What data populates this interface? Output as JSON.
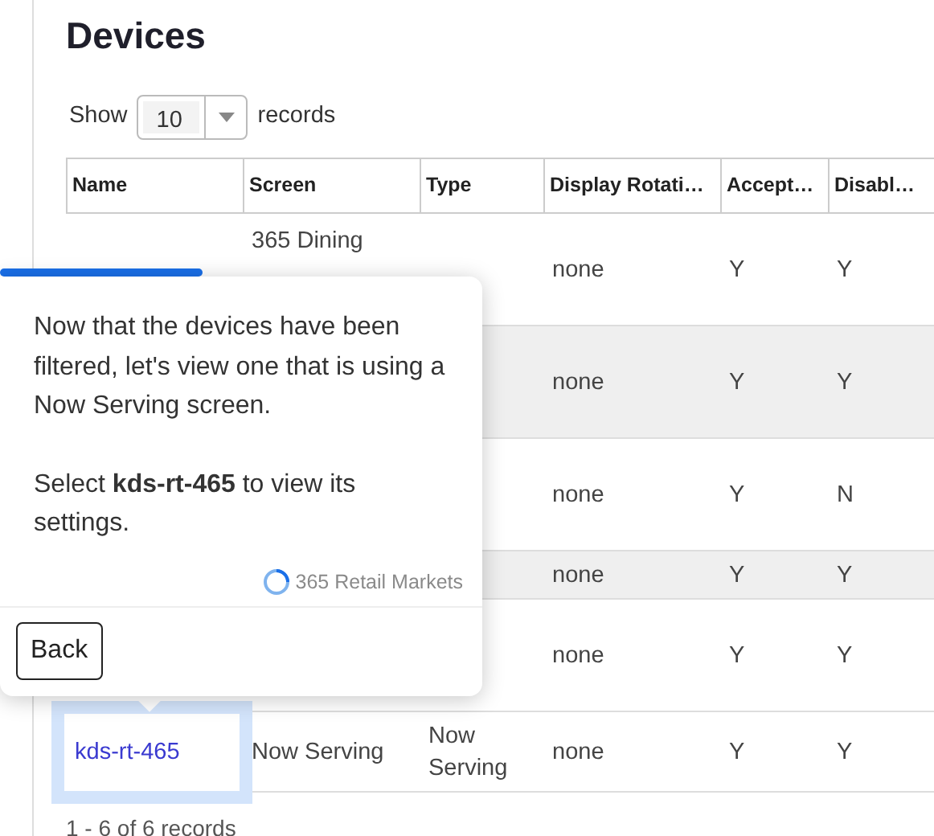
{
  "page_title": "Devices",
  "show_records": {
    "before": "Show",
    "value": "10",
    "after": "records"
  },
  "table": {
    "columns": [
      "Name",
      "Screen",
      "Type",
      "Display Rotati…",
      "Accept…",
      "Disabl…"
    ],
    "rows": [
      {
        "screen": "365 Dining",
        "rotation": "none",
        "accept": "Y",
        "disable": "Y",
        "shaded": false
      },
      {
        "rotation": "none",
        "accept": "Y",
        "disable": "Y",
        "shaded": true
      },
      {
        "rotation": "none",
        "accept": "Y",
        "disable": "N",
        "shaded": false
      },
      {
        "rotation": "none",
        "accept": "Y",
        "disable": "Y",
        "shaded": true
      },
      {
        "rotation": "none",
        "accept": "Y",
        "disable": "Y",
        "shaded": false
      },
      {
        "shaded": false,
        "name": "kds-rt-465",
        "screen": "Now Serving",
        "type": "Now Serving",
        "rotation": "none",
        "accept": "Y",
        "disable": "Y",
        "highlighted": true
      }
    ]
  },
  "pager_text": "1 - 6 of 6 records",
  "tour": {
    "level": 0.42,
    "message": "Now that the devices have been filtered, let's view one that is using a Now Serving screen.",
    "instruction": "Select **kds-rt-465** to view its settings.",
    "brand": "365 Retail Markets",
    "back": "Back"
  }
}
